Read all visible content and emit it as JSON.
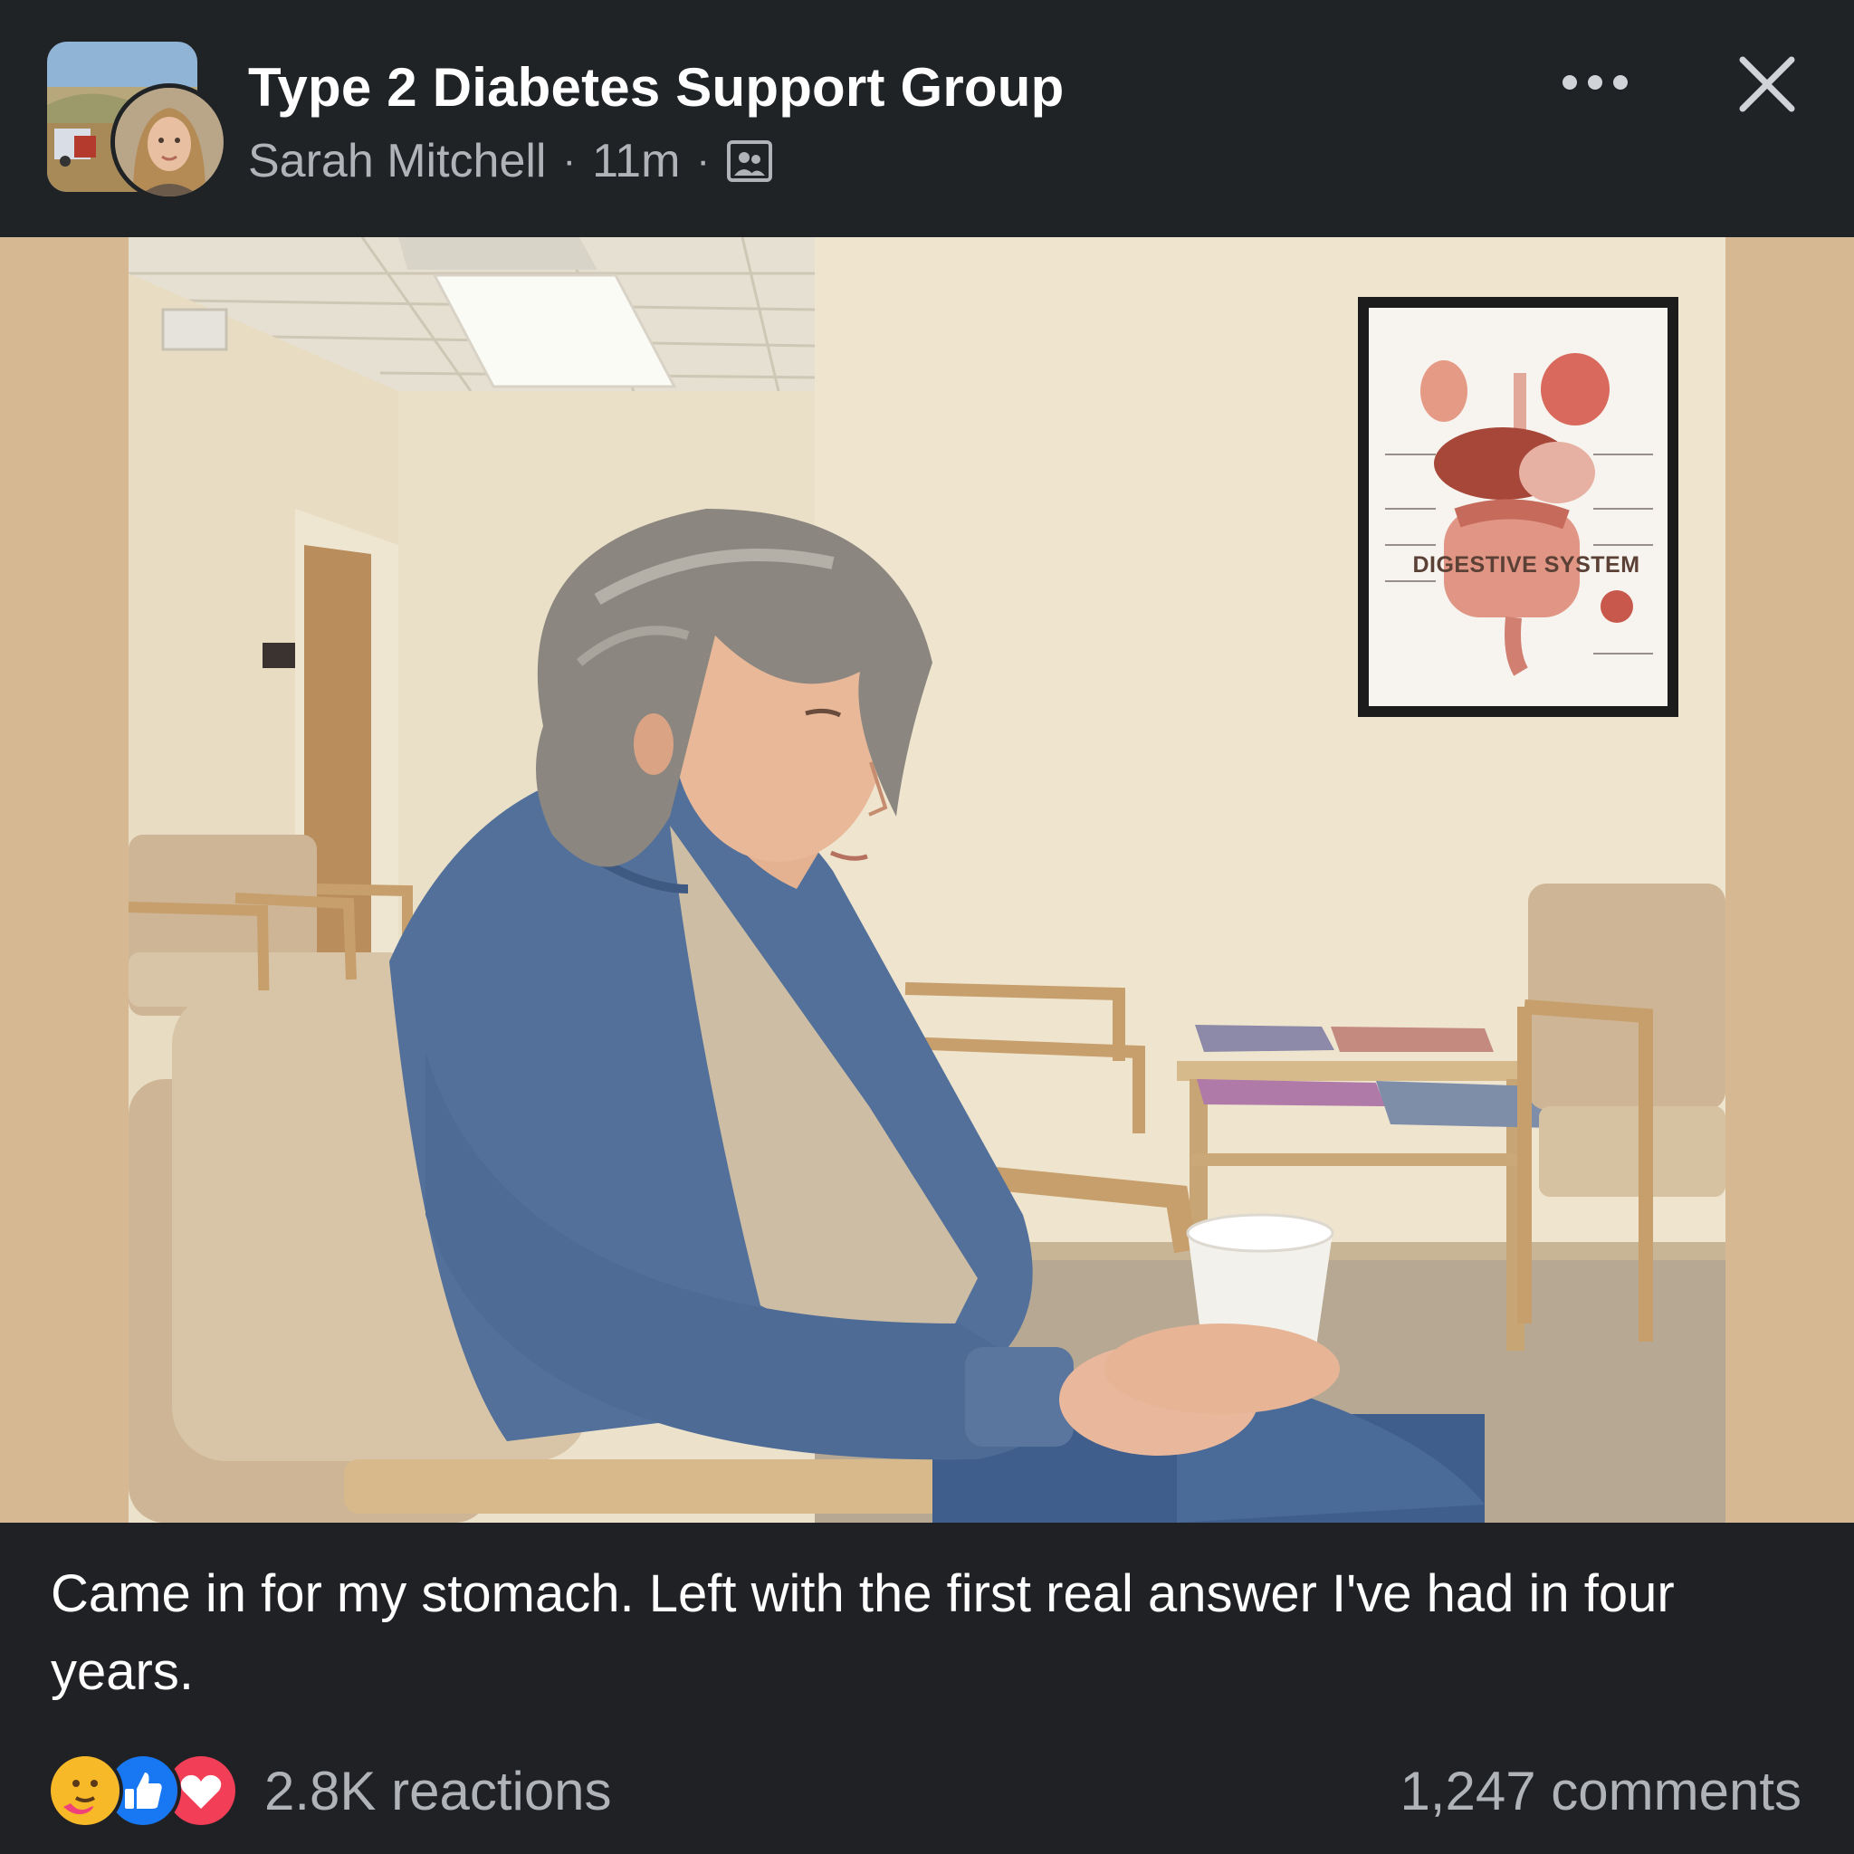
{
  "post": {
    "group_name": "Type 2 Diabetes Support Group",
    "author": "Sarah Mitchell",
    "time": "11m",
    "separator": "·",
    "privacy_icon": "group-members-icon",
    "more_icon": "more-horizontal-icon",
    "close_icon": "close-icon"
  },
  "photo": {
    "poster_title": "DIGESTIVE SYSTEM"
  },
  "caption": "Came in for my stomach. Left with the first real answer I've had in four years.",
  "engagement": {
    "reaction_icons": [
      "care-icon",
      "like-icon",
      "love-icon"
    ],
    "reactions": "2.8K reactions",
    "comments": "1,247 comments"
  },
  "colors": {
    "header_bg": "#202326",
    "page_bg": "#1f2124",
    "primary_text": "#ffffff",
    "secondary_text": "#b0b3b8",
    "like_blue": "#1877f2",
    "love_red": "#f33e58",
    "care_yellow": "#f7b928"
  }
}
